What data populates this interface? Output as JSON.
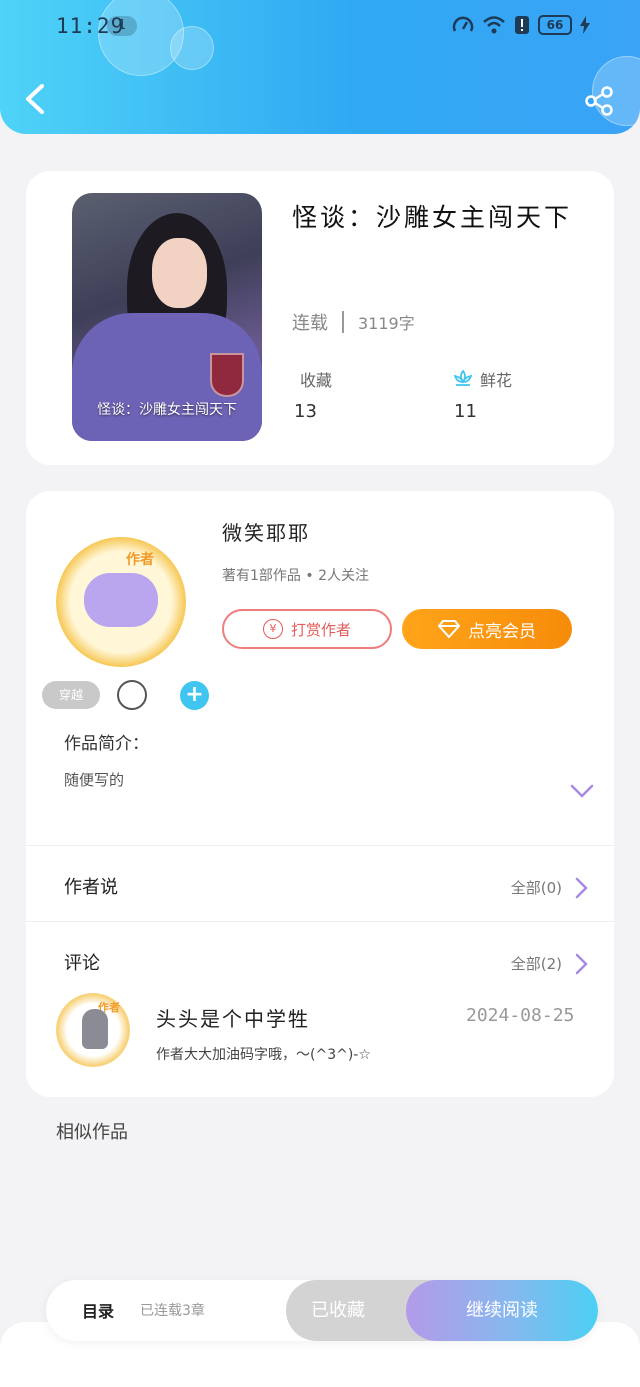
{
  "status_bar": {
    "time": "11:29",
    "notif_count": "1",
    "battery": "66"
  },
  "book": {
    "cover_text": "怪谈：沙雕女主闯天下",
    "title": "怪谈：沙雕女主闯天下",
    "status": "连载",
    "word_count": "3119字",
    "favorites_label": "收藏",
    "favorites_count": "13",
    "flowers_label": "鲜花",
    "flowers_count": "11"
  },
  "author": {
    "badge": "作者",
    "name": "微笑耶耶",
    "summary": "著有1部作品 • 2人关注",
    "tip_label": "打赏作者",
    "vip_label": "点亮会员",
    "tag": "穿越"
  },
  "intro": {
    "label": "作品简介：",
    "text": "随便写的"
  },
  "author_says": {
    "title": "作者说",
    "all": "全部(0)"
  },
  "comments": {
    "title": "评论",
    "all": "全部(2)",
    "items": [
      {
        "badge": "作者",
        "name": "头头是个中学牲",
        "date": "2024-08-25",
        "text": "作者大大加油码字哦，～(^3^)-☆"
      }
    ]
  },
  "similar_title": "相似作品",
  "bottom": {
    "toc": "目录",
    "toc_sub": "已连载3章",
    "faved": "已收藏",
    "read": "继续阅读"
  },
  "colors": {
    "accent_blue": "#2fa9f2",
    "vip_orange": "#f68c0a",
    "tip_red": "#e55b5b"
  },
  "icons": [
    "back-icon",
    "share-icon",
    "flower-icon",
    "diamond-icon",
    "yen-icon",
    "chevron-down-icon",
    "chevron-right-icon",
    "plus-icon"
  ]
}
